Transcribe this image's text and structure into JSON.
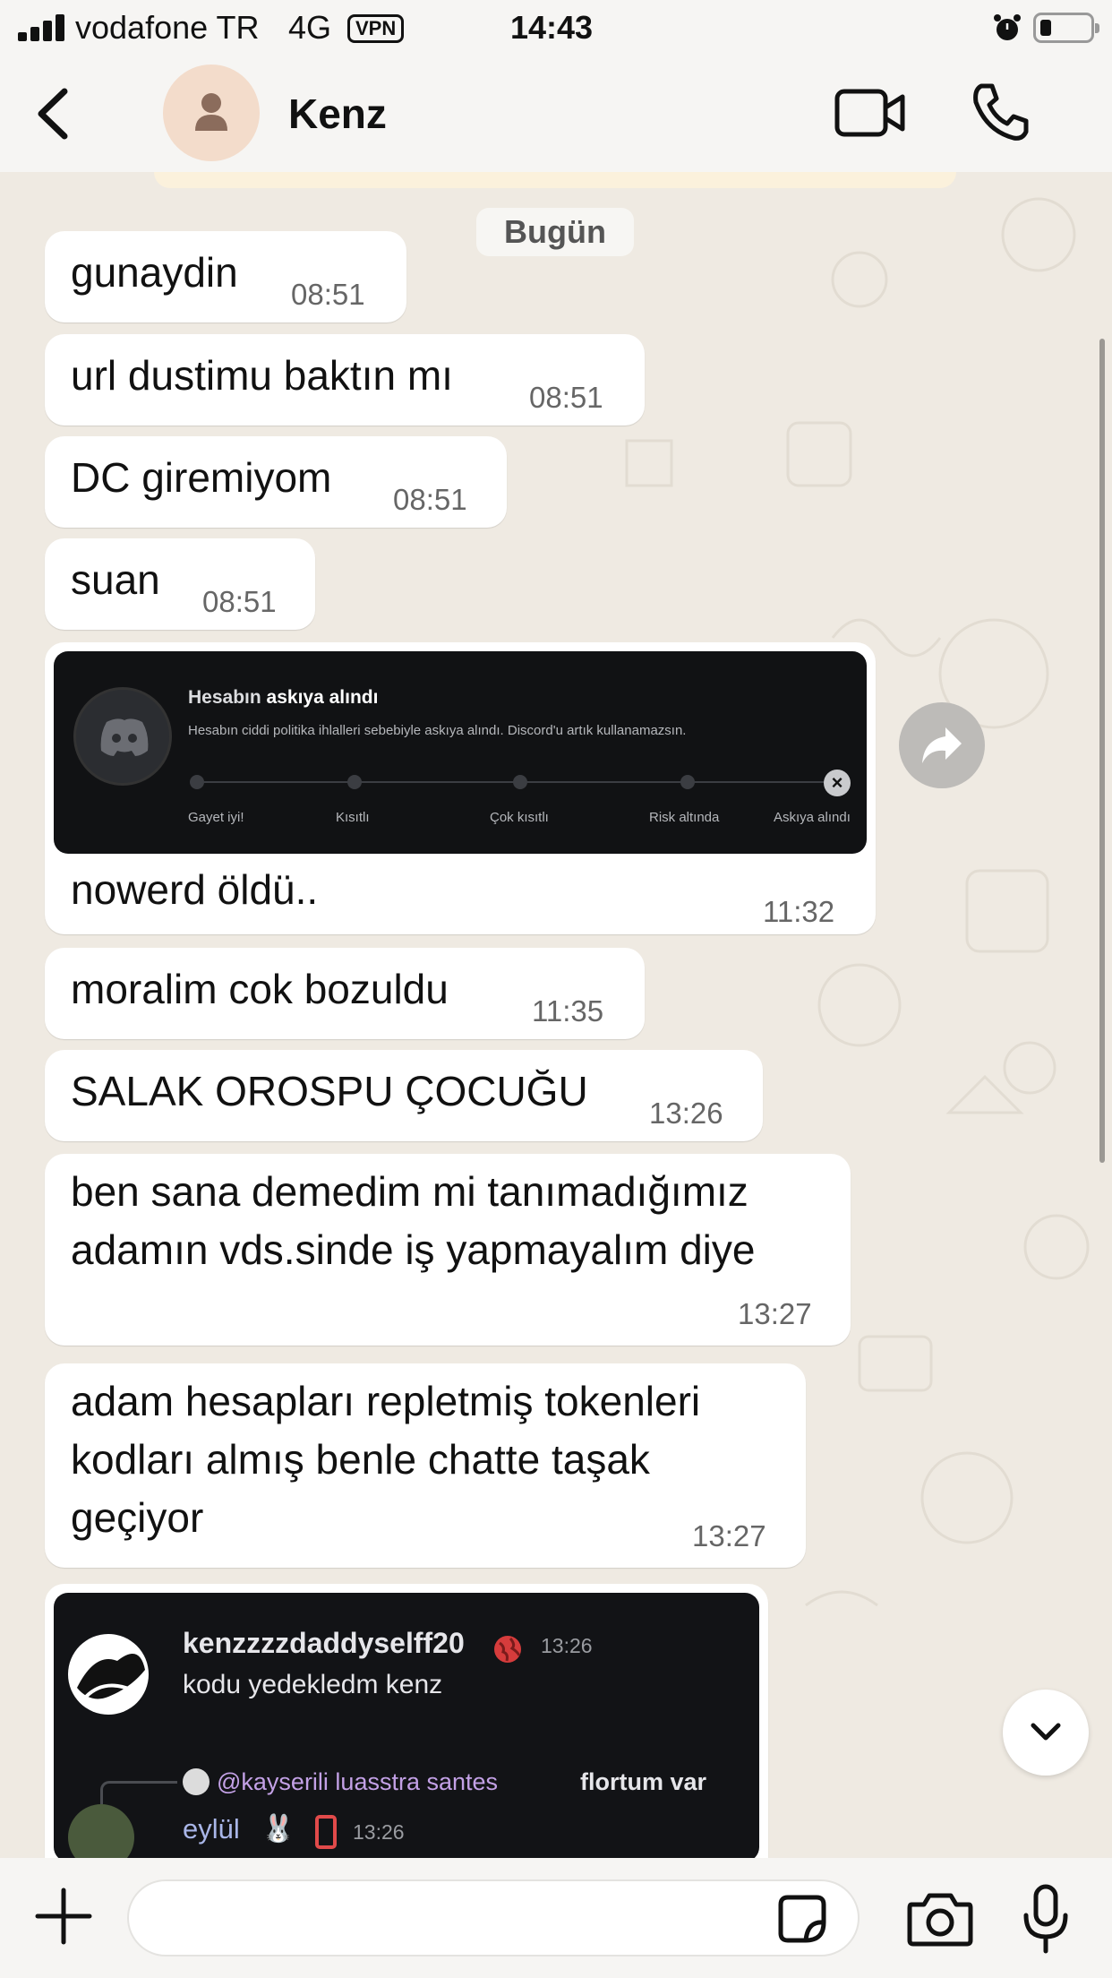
{
  "status_bar": {
    "carrier": "vodafone TR",
    "network": "4G",
    "vpn": "VPN",
    "time": "14:43"
  },
  "header": {
    "back_icon": "chevron-left-icon",
    "contact_name": "Kenz",
    "video_icon": "video-camera-icon",
    "call_icon": "phone-icon"
  },
  "chat": {
    "date_chip": "Bugün",
    "messages": [
      {
        "text": "gunaydin",
        "time": "08:51"
      },
      {
        "text": "url dustimu baktın mı",
        "time": "08:51"
      },
      {
        "text": "DC giremiyom",
        "time": "08:51"
      },
      {
        "text": "suan",
        "time": "08:51"
      },
      {
        "text": "nowerd öldü..",
        "time": "11:32"
      },
      {
        "text": "moralim cok bozuldu",
        "time": "11:35"
      },
      {
        "text": "SALAK OROSPU ÇOCUĞU",
        "time": "13:26"
      },
      {
        "text": "ben sana demedim mi tanımadığımız adamın vds.sinde iş yapmayalım diye",
        "time": "13:27"
      },
      {
        "text": "adam hesapları repletmiş tokenleri kodları almış benle chatte taşak geçiyor",
        "time": "13:27"
      }
    ],
    "ban_image": {
      "title_prefix": "Hesabın",
      "title_bold": "askıya alındı",
      "description": "Hesabın ciddi politika ihlalleri sebebiyle askıya alındı. Discord'u artık kullanamazsın.",
      "steps": [
        "Gayet iyi!",
        "Kısıtlı",
        "Çok kısıtlı",
        "Risk altında",
        "Askıya alındı"
      ]
    },
    "discord_chat_image": {
      "username": "kenzzzzdaddyselff20",
      "time1": "13:26",
      "message": "kodu yedekledm kenz",
      "reply_mention": "@kayserili luasstra santes",
      "reply_text": "flortum var",
      "username2": "eylül",
      "time2": "13:26"
    }
  },
  "composer": {
    "plus_icon": "plus-icon",
    "input_value": "",
    "sticker_icon": "sticker-icon",
    "camera_icon": "camera-icon",
    "mic_icon": "microphone-icon"
  },
  "colors": {
    "chat_bg": "#efeae2",
    "bubble_bg": "#ffffff",
    "bar_bg": "#f6f5f3",
    "avatar_bg": "#f3dccb"
  }
}
